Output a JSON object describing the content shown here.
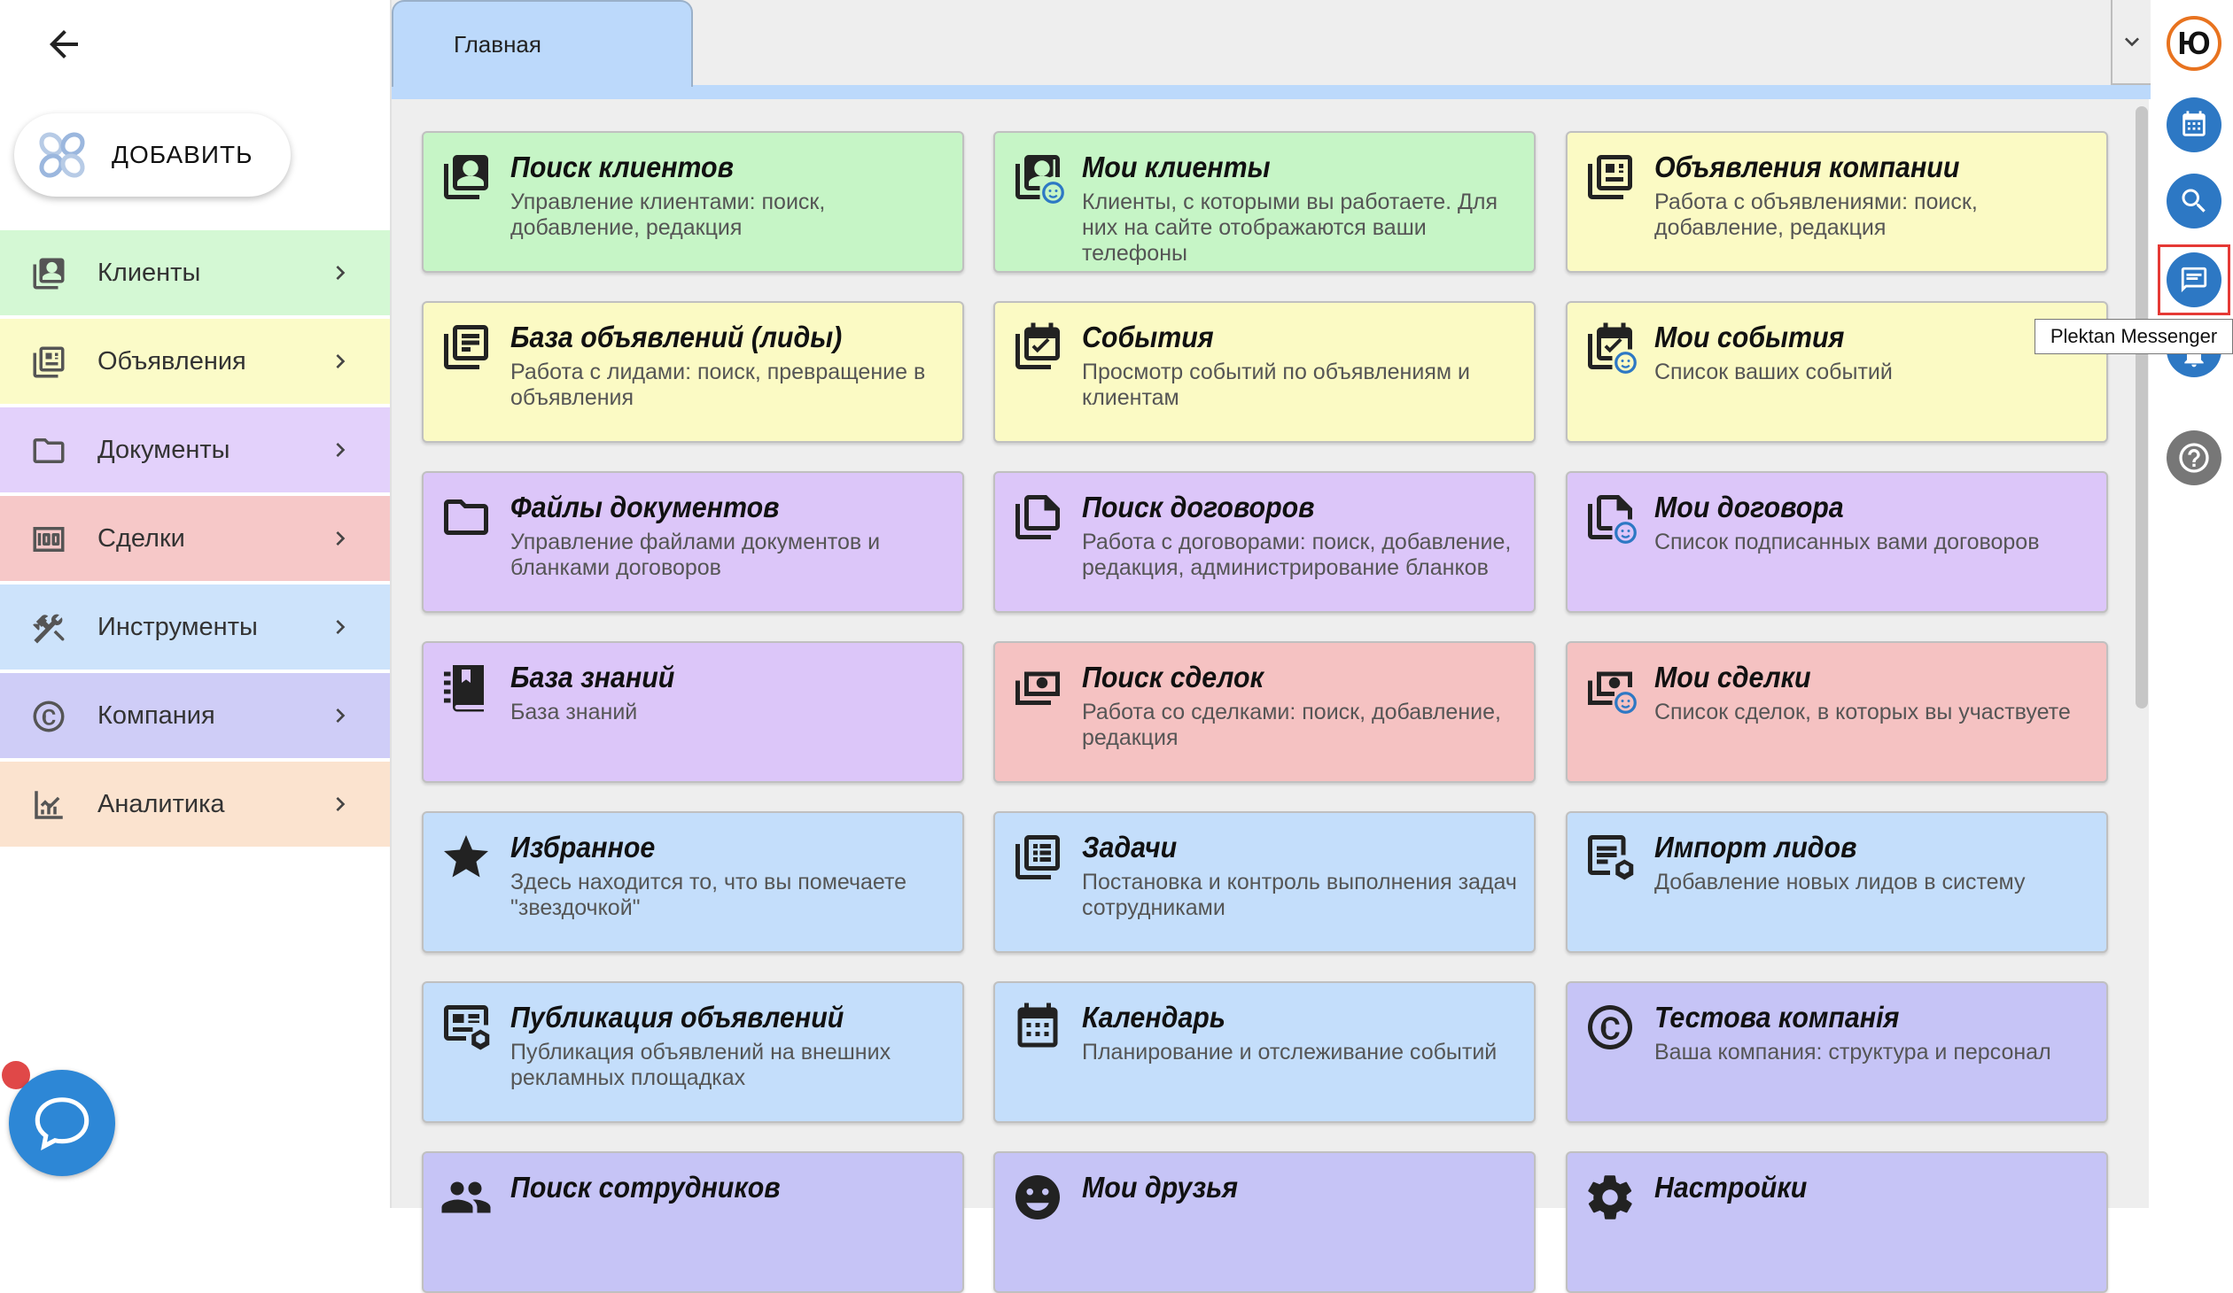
{
  "sidebar": {
    "add_label": "ДОБАВИТЬ",
    "items": [
      {
        "label": "Клиенты",
        "icon": "clients-icon",
        "color": "#d4f8d4"
      },
      {
        "label": "Объявления",
        "icon": "ads-icon",
        "color": "#fbfbc8"
      },
      {
        "label": "Документы",
        "icon": "folder-icon",
        "color": "#e3d1fb"
      },
      {
        "label": "Сделки",
        "icon": "money-icon",
        "color": "#f6c8c8"
      },
      {
        "label": "Инструменты",
        "icon": "tools-icon",
        "color": "#cde3fb"
      },
      {
        "label": "Компания",
        "icon": "copyright-icon",
        "color": "#cfcdf7"
      },
      {
        "label": "Аналитика",
        "icon": "analytics-icon",
        "color": "#fbe3cf"
      }
    ]
  },
  "tabs": {
    "home": "Главная"
  },
  "cards": [
    {
      "title": "Поиск клиентов",
      "desc": "Управление клиентами: поиск, добавление, редакция",
      "icon": "contact-card-icon",
      "color": "green"
    },
    {
      "title": "Мои клиенты",
      "desc": "Клиенты, с которыми вы работаете. Для них на сайте отображаются ваши телефоны",
      "icon": "my-clients-icon",
      "color": "green"
    },
    {
      "title": "Объявления компании",
      "desc": "Работа с объявлениями: поиск, добавление, редакция",
      "icon": "company-ads-icon",
      "color": "yellow"
    },
    {
      "title": "База объявлений (лиды)",
      "desc": "Работа с лидами: поиск, превращение в объявления",
      "icon": "leads-base-icon",
      "color": "yellow"
    },
    {
      "title": "События",
      "desc": "Просмотр событий по объявлениям и клиентам",
      "icon": "event-check-icon",
      "color": "yellow"
    },
    {
      "title": "Мои события",
      "desc": "Список ваших событий",
      "icon": "my-events-icon",
      "color": "yellow"
    },
    {
      "title": "Файлы документов",
      "desc": "Управление файлами документов и бланками договоров",
      "icon": "folder-icon",
      "color": "purple"
    },
    {
      "title": "Поиск договоров",
      "desc": "Работа с договорами: поиск, добавление, редакция, администрирование бланков",
      "icon": "documents-icon",
      "color": "purple"
    },
    {
      "title": "Мои договора",
      "desc": "Список подписанных вами договоров",
      "icon": "my-contracts-icon",
      "color": "purple"
    },
    {
      "title": "База знаний",
      "desc": "База знаний",
      "icon": "knowledge-book-icon",
      "color": "purple"
    },
    {
      "title": "Поиск сделок",
      "desc": "Работа со сделками: поиск, добавление, редакция",
      "icon": "money-icon",
      "color": "red"
    },
    {
      "title": "Мои сделки",
      "desc": "Список сделок, в которых вы участвуете",
      "icon": "my-deals-icon",
      "color": "red"
    },
    {
      "title": "Избранное",
      "desc": "Здесь находится то, что вы помечаете \"звездочкой\"",
      "icon": "star-icon",
      "color": "blue"
    },
    {
      "title": "Задачи",
      "desc": "Постановка и контроль выполнения задач сотрудниками",
      "icon": "tasks-icon",
      "color": "blue"
    },
    {
      "title": "Импорт лидов",
      "desc": "Добавление новых лидов в систему",
      "icon": "import-leads-icon",
      "color": "blue"
    },
    {
      "title": "Публикация объявлений",
      "desc": "Публикация объявлений на внешних рекламных площадках",
      "icon": "publish-ads-icon",
      "color": "blue"
    },
    {
      "title": "Календарь",
      "desc": "Планирование и отслеживание событий",
      "icon": "calendar-icon",
      "color": "blue"
    },
    {
      "title": "Тестова компанія",
      "desc": "Ваша компания: структура и персонал",
      "icon": "copyright-icon",
      "color": "lav"
    },
    {
      "title": "Поиск сотрудников",
      "desc": "",
      "icon": "people-icon",
      "color": "lav"
    },
    {
      "title": "Мои друзья",
      "desc": "",
      "icon": "friends-icon",
      "color": "lav"
    },
    {
      "title": "Настройки",
      "desc": "",
      "icon": "gear-icon",
      "color": "lav"
    }
  ],
  "rail": {
    "avatar_letter": "Ю",
    "tooltip": "Plektan Messenger"
  }
}
